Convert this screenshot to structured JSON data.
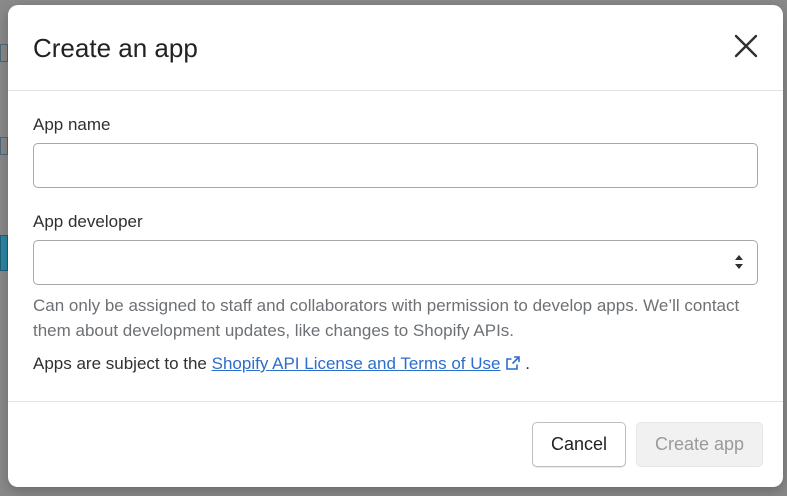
{
  "modal": {
    "title": "Create an app",
    "close_icon": "close-icon"
  },
  "form": {
    "app_name": {
      "label": "App name",
      "value": "",
      "placeholder": ""
    },
    "app_developer": {
      "label": "App developer",
      "selected_value": "",
      "help_text": "Can only be assigned to staff and collaborators with permission to develop apps. We’ll contact them about development updates, like changes to Shopify APIs."
    },
    "terms": {
      "prefix": "Apps are subject to the",
      "link_text": "Shopify API License and Terms of Use",
      "suffix": ".",
      "link_icon": "external-link-icon"
    }
  },
  "footer": {
    "cancel_label": "Cancel",
    "create_label": "Create app",
    "create_enabled": false
  },
  "colors": {
    "link": "#2c6ecb",
    "disabled_text": "#9a9a9a",
    "disabled_bg": "#f1f1f1"
  }
}
